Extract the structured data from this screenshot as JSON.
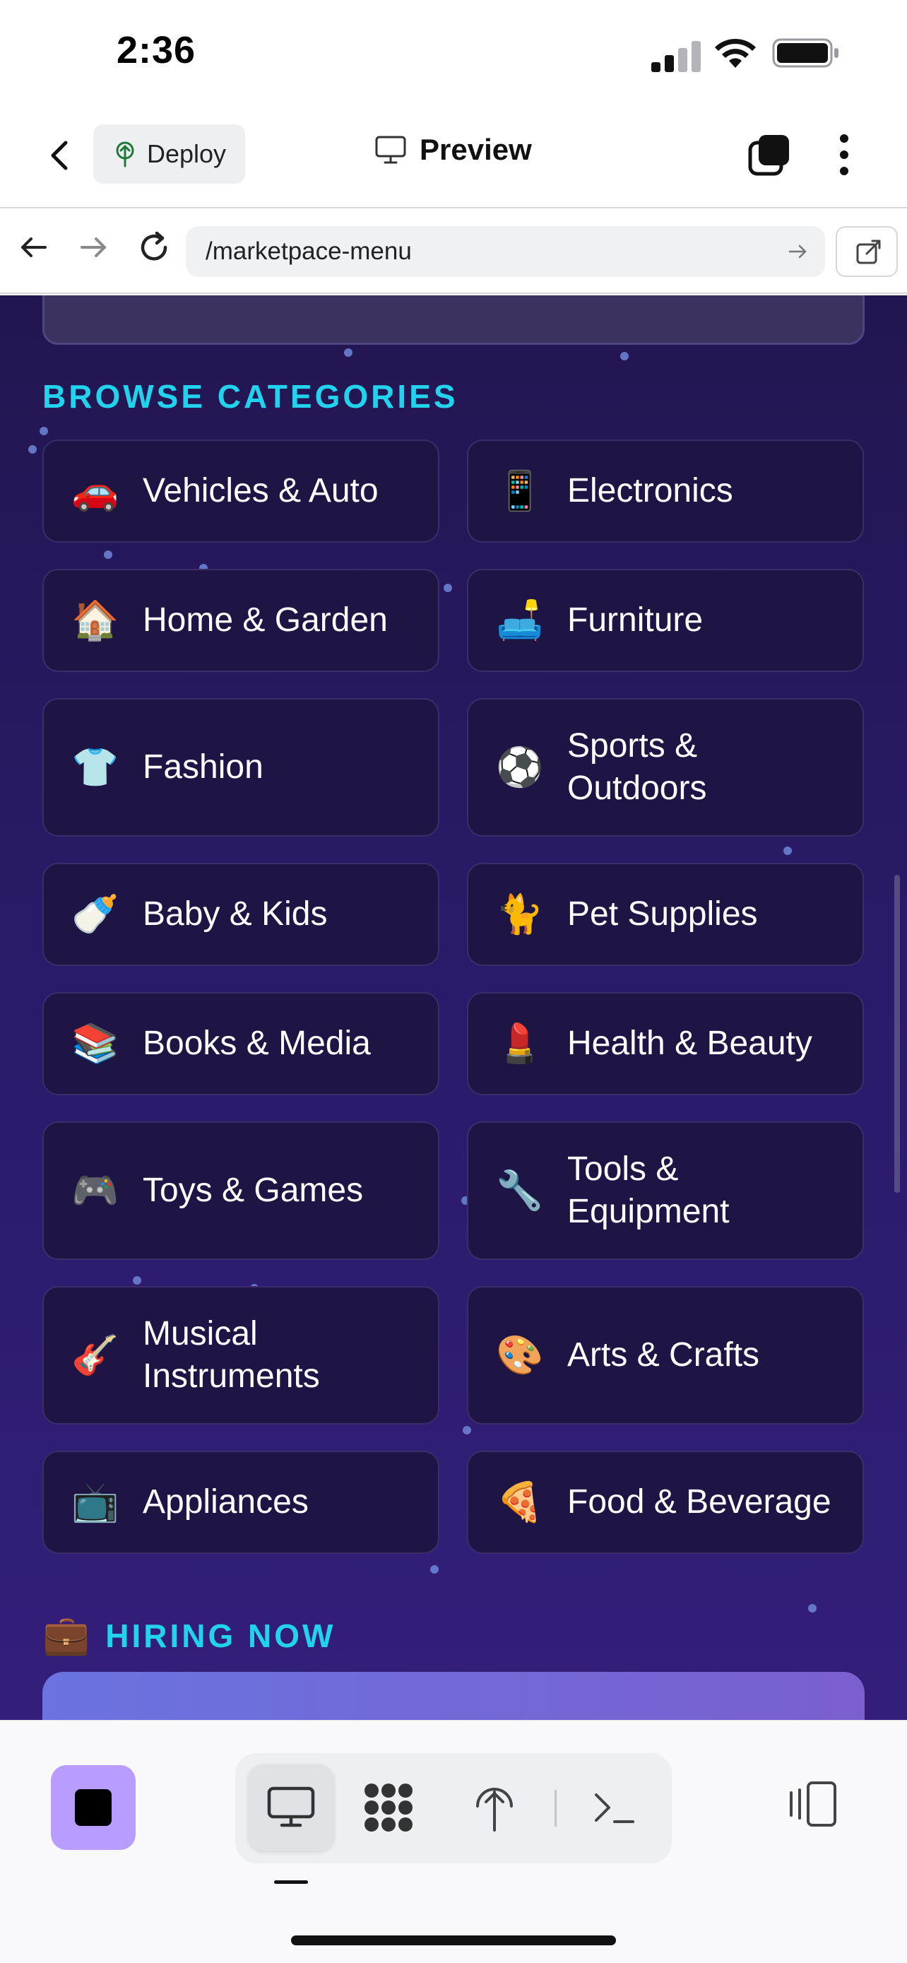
{
  "status_bar": {
    "time": "2:36"
  },
  "header": {
    "deploy_label": "Deploy",
    "preview_label": "Preview"
  },
  "browser": {
    "url": "/marketpace-menu"
  },
  "categories_section": {
    "title": "BROWSE CATEGORIES",
    "items": [
      {
        "emoji": "🚗",
        "label": "Vehicles & Auto"
      },
      {
        "emoji": "📱",
        "label": "Electronics"
      },
      {
        "emoji": "🏠",
        "label": "Home & Garden"
      },
      {
        "emoji": "🛋️",
        "label": "Furniture"
      },
      {
        "emoji": "👕",
        "label": "Fashion"
      },
      {
        "emoji": "⚽",
        "label": "Sports &\nOutdoors"
      },
      {
        "emoji": "🍼",
        "label": "Baby & Kids"
      },
      {
        "emoji": "🐈",
        "label": "Pet Supplies"
      },
      {
        "emoji": "📚",
        "label": "Books & Media"
      },
      {
        "emoji": "💄",
        "label": "Health & Beauty"
      },
      {
        "emoji": "🎮",
        "label": "Toys & Games"
      },
      {
        "emoji": "🔧",
        "label": "Tools &\nEquipment"
      },
      {
        "emoji": "🎸",
        "label": "Musical\nInstruments"
      },
      {
        "emoji": "🎨",
        "label": "Arts & Crafts"
      },
      {
        "emoji": "📺",
        "label": "Appliances"
      },
      {
        "emoji": "🍕",
        "label": "Food & Beverage"
      }
    ]
  },
  "hiring_section": {
    "emoji": "💼",
    "title": "HIRING NOW"
  },
  "toolbar": {
    "tools": [
      "preview-icon",
      "components-icon",
      "deploy-icon",
      "terminal-icon"
    ]
  },
  "colors": {
    "accent_cyan": "#22d3ee",
    "card_bg": "#1f1545",
    "content_bg": "#2a1a68",
    "stop_button": "#b99cff"
  }
}
